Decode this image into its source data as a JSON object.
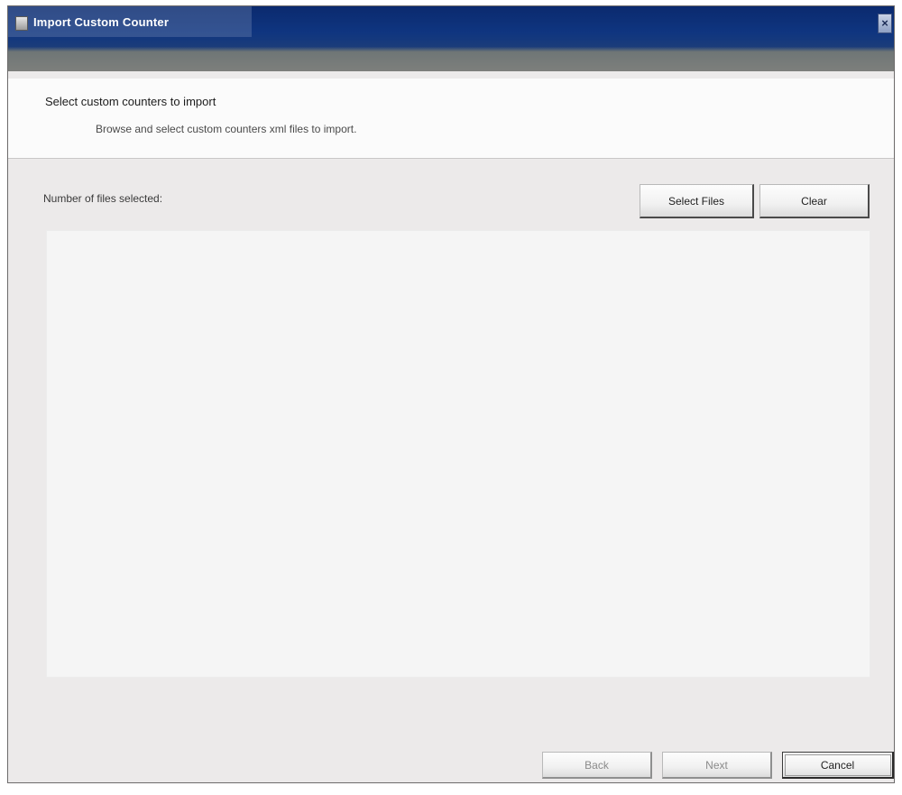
{
  "window": {
    "title": "Import Custom Counter",
    "close_glyph": "×",
    "icon": "app-icon"
  },
  "header": {
    "title": "Select custom counters to import",
    "subtitle": "Browse and select custom counters xml files to import."
  },
  "files": {
    "count_label": "Number of files selected:",
    "select_button": "Select Files",
    "clear_button": "Clear",
    "items": []
  },
  "footer": {
    "back_button": "Back",
    "next_button": "Next",
    "cancel_button": "Cancel"
  },
  "colors": {
    "titlebar": "#0f3580",
    "dialog_bg": "#eceaea",
    "header_bg": "#fbfbfb",
    "list_bg": "#f5f5f5"
  }
}
